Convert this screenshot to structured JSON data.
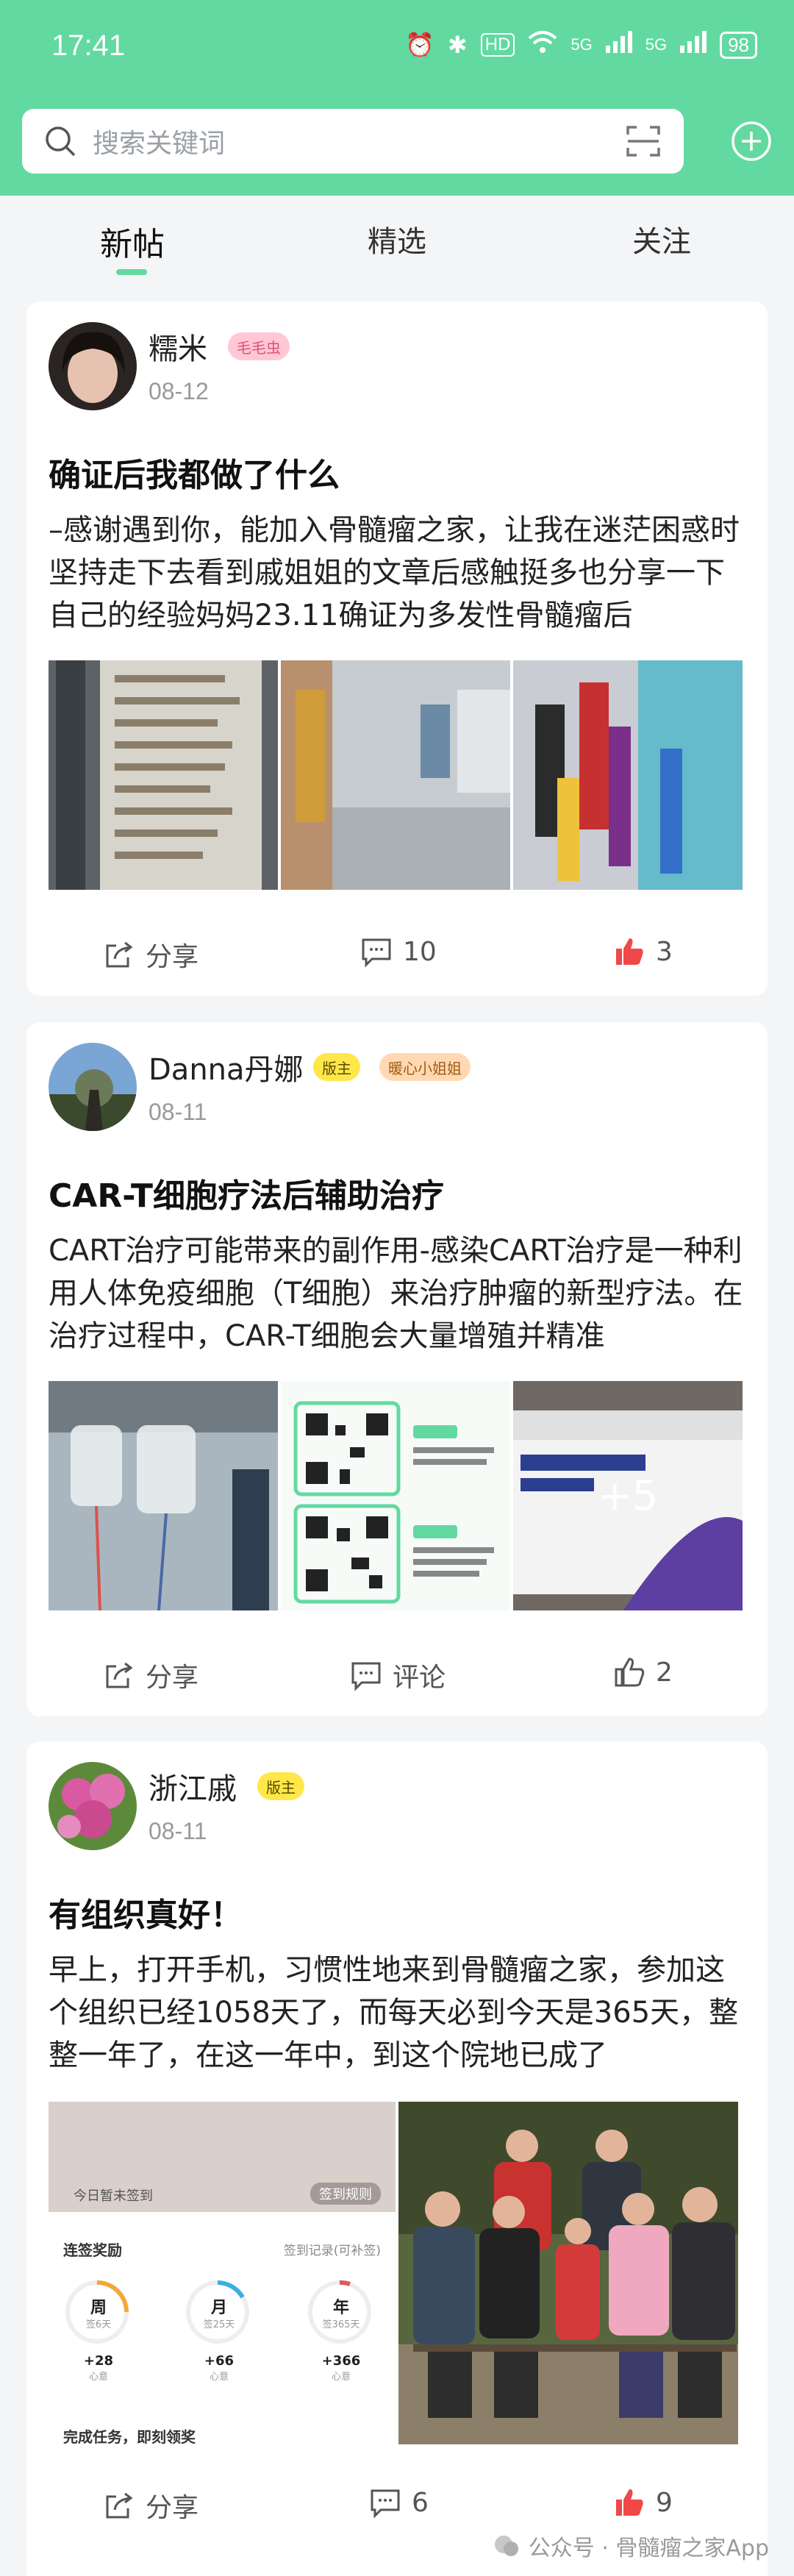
{
  "status_bar": {
    "time": "17:41",
    "battery": "98",
    "hd": "HD",
    "net1": "5G",
    "net2": "5G"
  },
  "search": {
    "placeholder": "搜索关键词"
  },
  "tabs": [
    {
      "label": "新帖"
    },
    {
      "label": "精选"
    },
    {
      "label": "关注"
    }
  ],
  "posts": [
    {
      "user": "糯米",
      "badges": [
        "毛毛虫"
      ],
      "date": "08-12",
      "title": "确证后我都做了什么",
      "excerpt": "–感谢遇到你，能加入骨髓瘤之家，让我在迷茫困惑时坚持走下去看到戚姐姐的文章后感触挺多也分享一下自己的经验妈妈23.11确证为多发性骨髓瘤后",
      "share": "分享",
      "comments": "10",
      "likes": "3"
    },
    {
      "user": "Danna丹娜",
      "badges": [
        "版主",
        "暖心小姐姐"
      ],
      "date": "08-11",
      "title": "CAR-T细胞疗法后辅助治疗",
      "excerpt": "CART治疗可能带来的副作用-感染CART治疗是一种利用人体免疫细胞（T细胞）来治疗肿瘤的新型疗法。在治疗过程中，CAR-T细胞会大量增殖并精准",
      "share": "分享",
      "comments": "评论",
      "likes": "2",
      "more_images": "+5"
    },
    {
      "user": "浙江戚",
      "badges": [
        "版主"
      ],
      "date": "08-11",
      "title": "有组织真好！",
      "excerpt": "早上，打开手机，习惯性地来到骨髓瘤之家，参加这个组织已经1058天了，而每天必到今天是365天，整整一年了，在这一年中，到这个院地已成了",
      "share": "分享",
      "comments": "6",
      "likes": "9",
      "screenshot": {
        "checkin": "今日暂未签到",
        "checkin_rule": "签到规则",
        "streak": "连签奖励",
        "record": "签到记录(可补签)",
        "levels": [
          {
            "name": "周",
            "sub": "签6天",
            "reward": "+28",
            "unit": "心意"
          },
          {
            "name": "月",
            "sub": "签25天",
            "reward": "+66",
            "unit": "心意"
          },
          {
            "name": "年",
            "sub": "签365天",
            "reward": "+366",
            "unit": "心意"
          }
        ],
        "bottom": "完成任务，即刻领奖"
      }
    }
  ],
  "watermark": "公众号 · 骨髓瘤之家App",
  "colors": {
    "accent": "#62d9a1",
    "like": "#f04848",
    "badge_mod": "#ffe74a",
    "badge_warm": "#ffd9b3",
    "badge_bug": "#ffc8d4"
  }
}
